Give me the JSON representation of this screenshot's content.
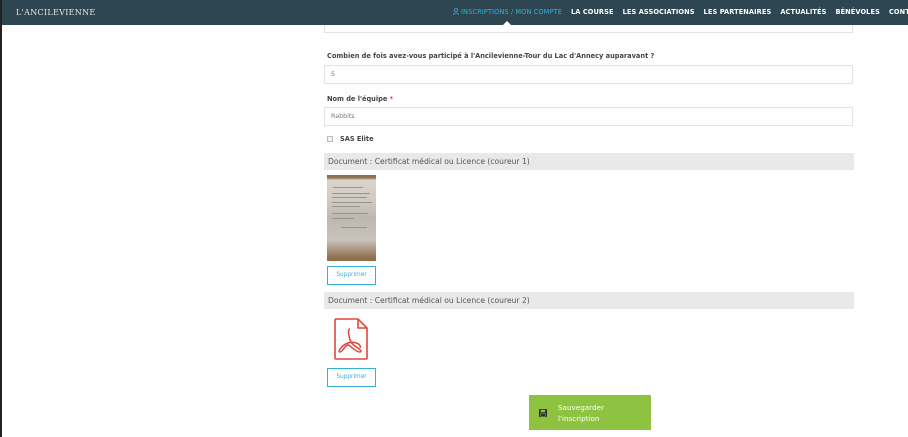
{
  "header": {
    "logo": "L'ANCILEVIENNE",
    "nav": [
      {
        "label": "INSCRIPTIONS / MON COMPTE",
        "active": true
      },
      {
        "label": "LA COURSE",
        "active": false
      },
      {
        "label": "LES ASSOCIATIONS",
        "active": false
      },
      {
        "label": "LES PARTENAIRES",
        "active": false
      },
      {
        "label": "ACTUALITÉS",
        "active": false
      },
      {
        "label": "BÉNÉVOLES",
        "active": false
      },
      {
        "label": "CONTA",
        "active": false
      }
    ]
  },
  "form": {
    "participation_label": "Combien de fois avez-vous participé à l'Ancilevienne-Tour du Lac d'Annecy auparavant ?",
    "participation_value": "5",
    "team_label": "Nom de l'équipe",
    "team_required": "*",
    "team_value": "Rabbits",
    "sas_elite_label": "SAS Elite",
    "doc1_title": "Document : Certificat médical ou Licence (coureur 1)",
    "doc1_delete": "Supprimer",
    "doc2_title": "Document : Certificat médical ou Licence (coureur 2)",
    "doc2_delete": "Supprimer",
    "save_label": "Sauvegarder l'inscription"
  },
  "colors": {
    "header_bg": "#2e4652",
    "accent": "#35b0d6",
    "save_green": "#8ec341",
    "pdf_red": "#e0463c"
  },
  "icons": [
    "user-icon",
    "pdf-file-icon",
    "save-disk-icon"
  ]
}
